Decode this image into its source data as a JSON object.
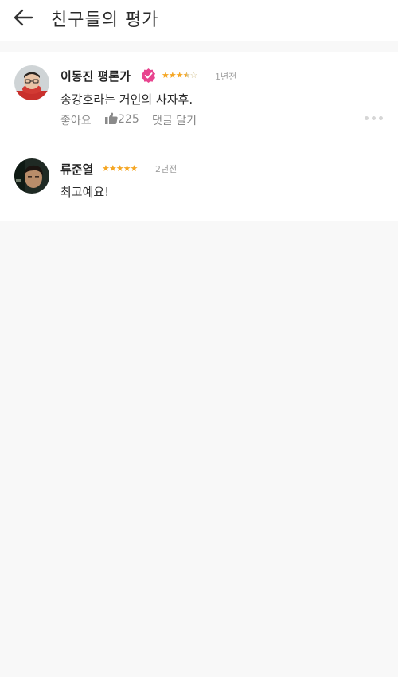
{
  "header": {
    "title": "친구들의 평가",
    "back_icon": "arrow-left-icon"
  },
  "reviews": [
    {
      "name": "이동진 평론가",
      "verified": true,
      "badge_color": "#e8448f",
      "rating": 3.5,
      "rating_max": 5,
      "time": "1년전",
      "comment": "송강호라는 거인의 사자후.",
      "like_label": "좋아요",
      "like_count": "225",
      "reply_label": "댓글 달기"
    },
    {
      "name": "류준열",
      "verified": false,
      "rating": 5,
      "rating_max": 5,
      "time": "2년전",
      "comment": "최고예요!"
    }
  ],
  "colors": {
    "star": "#f5a623",
    "background": "#f8f8f8",
    "card": "#ffffff"
  }
}
